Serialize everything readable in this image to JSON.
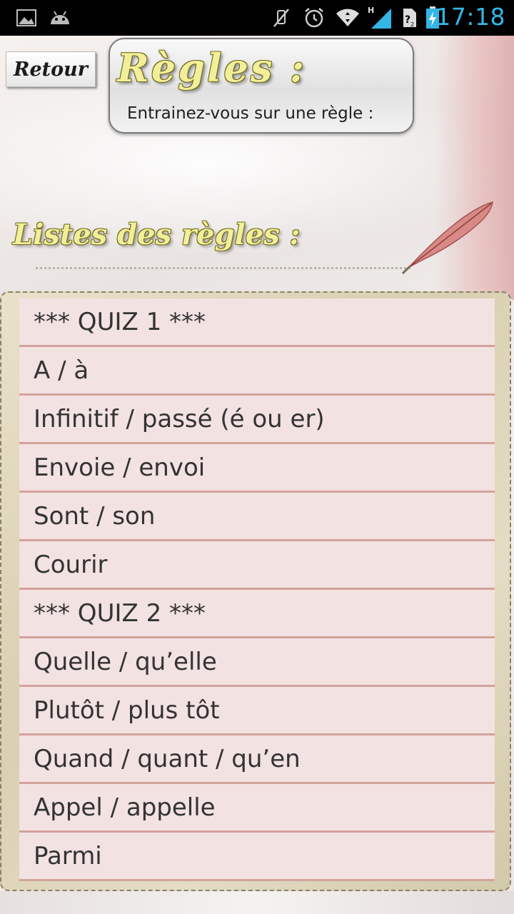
{
  "status_bar": {
    "time": "17:18",
    "icons": [
      "image-icon",
      "android-icon",
      "mute-icon",
      "alarm-icon",
      "wifi-icon",
      "signal-h-icon",
      "sim-2-icon",
      "battery-charging-icon"
    ]
  },
  "header": {
    "back_label": "Retour",
    "title": "Règles :",
    "subtitle": "Entrainez-vous sur une règle :"
  },
  "list_section": {
    "heading": "Listes des règles :",
    "items": [
      "*** QUIZ 1 ***",
      "A / à",
      "Infinitif / passé (é ou er)",
      "Envoie / envoi",
      "Sont / son",
      "Courir",
      "*** QUIZ 2 ***",
      "Quelle / qu’elle",
      "Plutôt / plus tôt",
      "Quand / quant / qu’en",
      "Appel / appelle",
      "Parmi"
    ]
  },
  "colors": {
    "accent_time": "#33b5e5",
    "list_item_bg": "#f3e2e2",
    "list_divider": "#d2a39c",
    "title_gold": "#f2ee9a"
  }
}
